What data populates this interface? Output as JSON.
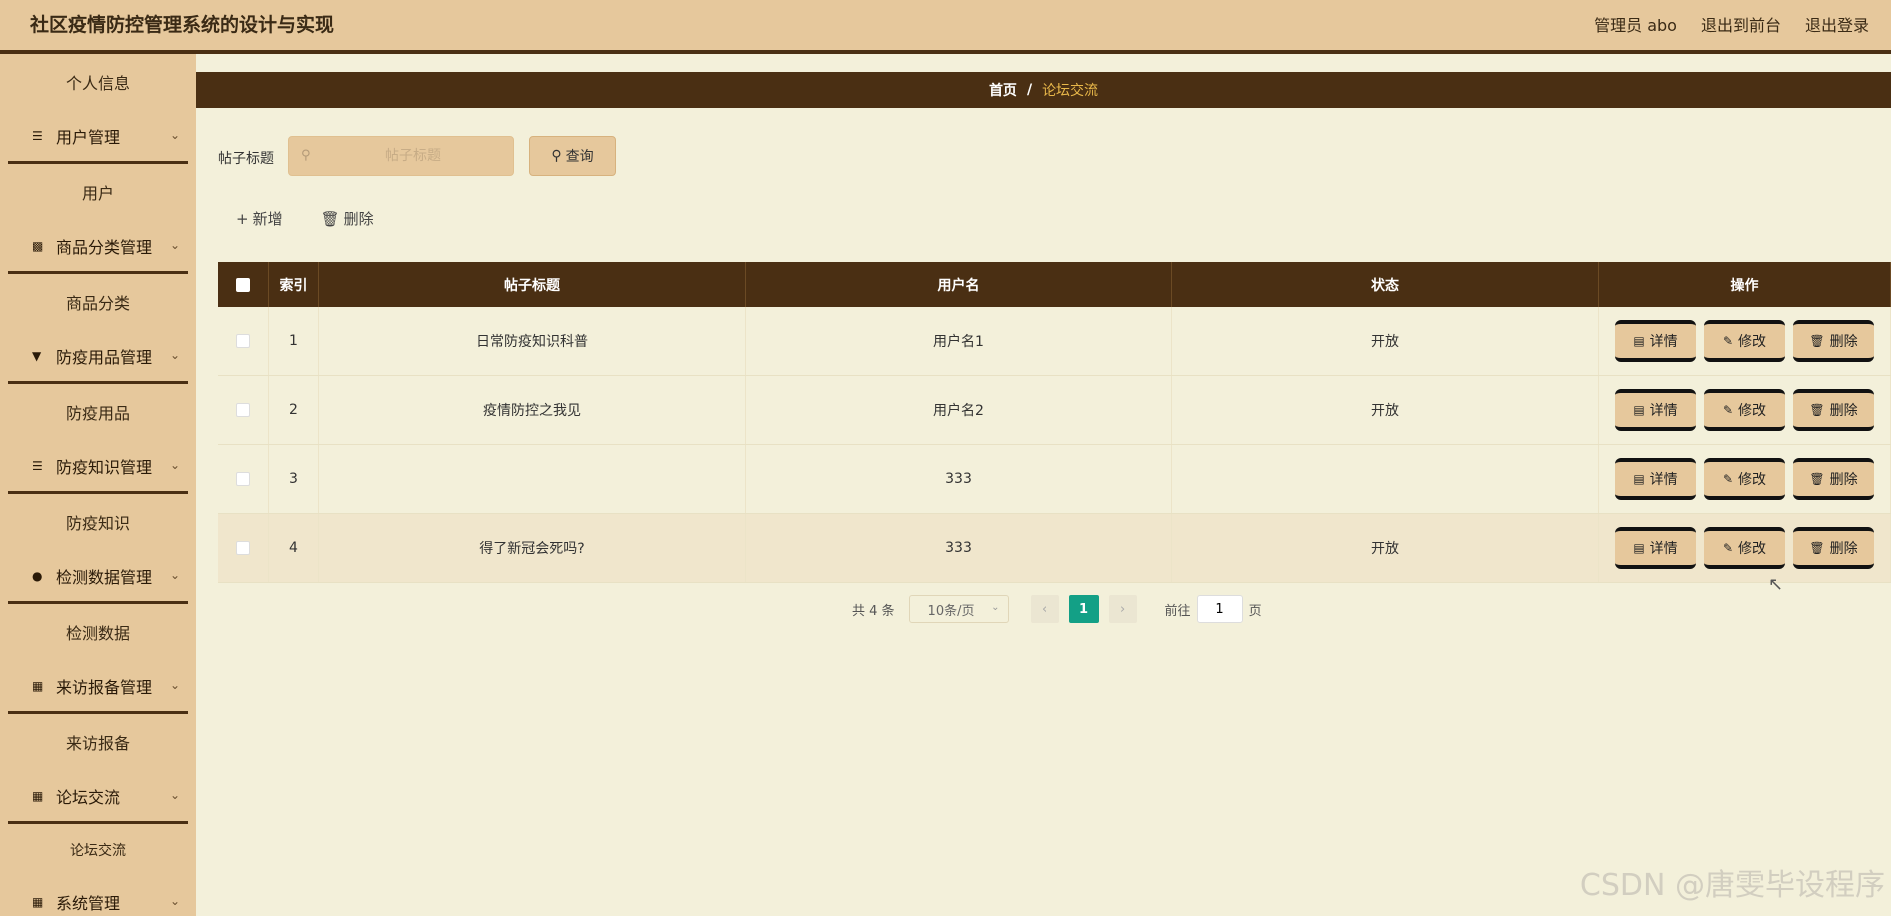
{
  "app": {
    "title": "社区疫情防控管理系统的设计与实现",
    "user_label": "管理员 abo",
    "back_to_front": "退出到前台",
    "logout": "退出登录"
  },
  "sidebar": {
    "items": [
      {
        "type": "sub",
        "label": "个人信息"
      },
      {
        "type": "group",
        "label": "用户管理",
        "icon": "list-icon"
      },
      {
        "type": "sub",
        "label": "用户"
      },
      {
        "type": "group",
        "label": "商品分类管理",
        "icon": "clipboard-icon"
      },
      {
        "type": "sub",
        "label": "商品分类"
      },
      {
        "type": "group",
        "label": "防疫用品管理",
        "icon": "pin-icon"
      },
      {
        "type": "sub",
        "label": "防疫用品"
      },
      {
        "type": "group",
        "label": "防疫知识管理",
        "icon": "list-icon"
      },
      {
        "type": "sub",
        "label": "防疫知识"
      },
      {
        "type": "group",
        "label": "检测数据管理",
        "icon": "user-icon"
      },
      {
        "type": "sub",
        "label": "检测数据"
      },
      {
        "type": "group",
        "label": "来访报备管理",
        "icon": "grid-icon"
      },
      {
        "type": "sub",
        "label": "来访报备"
      },
      {
        "type": "group",
        "label": "论坛交流",
        "icon": "grid-icon"
      },
      {
        "type": "sub",
        "label": "论坛交流"
      },
      {
        "type": "group",
        "label": "系统管理",
        "icon": "grid-icon"
      }
    ]
  },
  "breadcrumb": {
    "home": "首页",
    "separator": "/",
    "current": "论坛交流"
  },
  "search": {
    "label": "帖子标题",
    "placeholder": "帖子标题",
    "value": "",
    "button": "查询"
  },
  "toolbar": {
    "add": "新增",
    "delete": "删除"
  },
  "table": {
    "columns": [
      "索引",
      "帖子标题",
      "用户名",
      "状态",
      "操作"
    ],
    "rows": [
      {
        "index": "1",
        "title": "日常防疫知识科普",
        "username": "用户名1",
        "status": "开放"
      },
      {
        "index": "2",
        "title": "疫情防控之我见",
        "username": "用户名2",
        "status": "开放"
      },
      {
        "index": "3",
        "title": "",
        "username": "333",
        "status": ""
      },
      {
        "index": "4",
        "title": "得了新冠会死吗?",
        "username": "333",
        "status": "开放"
      }
    ],
    "actions": {
      "detail": "详情",
      "edit": "修改",
      "delete": "删除"
    }
  },
  "pagination": {
    "total": "共 4 条",
    "page_size": "10条/页",
    "current_page": "1",
    "goto_prefix": "前往",
    "goto_value": "1",
    "goto_suffix": "页"
  },
  "watermark": "CSDN @唐雯毕设程序"
}
